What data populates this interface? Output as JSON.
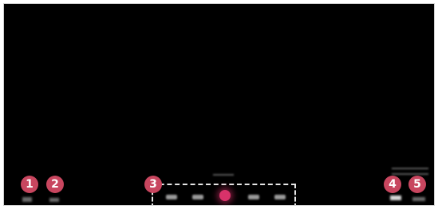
{
  "callouts": [
    {
      "number": "1",
      "target": "left-control-1"
    },
    {
      "number": "2",
      "target": "left-control-2"
    },
    {
      "number": "3",
      "target": "playback-controls"
    },
    {
      "number": "4",
      "target": "right-control-4"
    },
    {
      "number": "5",
      "target": "right-control-5"
    }
  ],
  "controls": {
    "left": [
      "blurred-control-icon",
      "blurred-control-icon"
    ],
    "transport": [
      "skip-back-icon",
      "rewind-icon",
      "play-icon",
      "fast-forward-icon",
      "skip-forward-icon"
    ],
    "right": [
      "blurred-control-icon",
      "blurred-control-icon"
    ]
  },
  "colors": {
    "callout": "#c8465f",
    "play_accent": "#d8326a",
    "background": "#000000",
    "dashed_border": "#e6e6e6"
  }
}
